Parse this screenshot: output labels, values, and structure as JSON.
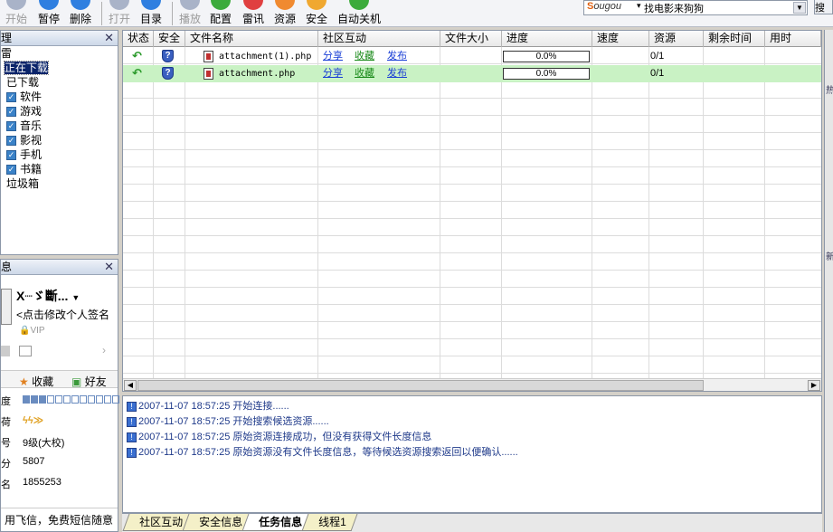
{
  "toolbar": {
    "items": [
      {
        "label": "开始",
        "icon": "start-icon",
        "disabled": true
      },
      {
        "label": "暂停",
        "icon": "pause-icon",
        "disabled": false
      },
      {
        "label": "删除",
        "icon": "delete-icon",
        "disabled": false
      },
      {
        "label": "打开",
        "icon": "open-icon",
        "disabled": true
      },
      {
        "label": "目录",
        "icon": "folder-icon",
        "disabled": false
      },
      {
        "label": "播放",
        "icon": "play-icon",
        "disabled": true
      },
      {
        "label": "配置",
        "icon": "config-icon",
        "disabled": false
      },
      {
        "label": "雷讯",
        "icon": "chat-icon",
        "disabled": false
      },
      {
        "label": "资源",
        "icon": "resource-icon",
        "disabled": false
      },
      {
        "label": "安全",
        "icon": "security-icon",
        "disabled": false
      },
      {
        "label": "自动关机",
        "icon": "shutdown-icon",
        "disabled": false
      }
    ]
  },
  "search": {
    "logo_prefix": "S",
    "logo_text": "ougou",
    "value": "找电影来狗狗",
    "button_label": "搜"
  },
  "task_panel": {
    "title": "理",
    "root": "雷",
    "items": [
      {
        "label": "正在下载",
        "selected": true,
        "checkbox": false
      },
      {
        "label": "已下载",
        "selected": false,
        "checkbox": false
      },
      {
        "label": "软件",
        "selected": false,
        "checkbox": true
      },
      {
        "label": "游戏",
        "selected": false,
        "checkbox": true
      },
      {
        "label": "音乐",
        "selected": false,
        "checkbox": true
      },
      {
        "label": "影视",
        "selected": false,
        "checkbox": true
      },
      {
        "label": "手机",
        "selected": false,
        "checkbox": true
      },
      {
        "label": "书籍",
        "selected": false,
        "checkbox": true
      },
      {
        "label": "垃圾箱",
        "selected": false,
        "checkbox": false
      }
    ]
  },
  "user_panel": {
    "title": "息",
    "username": "X┈ゞ斷...",
    "signature": "<点击修改个人签名",
    "vip": "VIP",
    "tabs": [
      "收藏",
      "好友"
    ],
    "info_rows": [
      {
        "label": "度",
        "value": ""
      },
      {
        "label": "荷",
        "value": ""
      },
      {
        "label": "号",
        "value": "9级(大校)"
      },
      {
        "label": "分",
        "value": "5807"
      },
      {
        "label": "名",
        "value": "1855253"
      }
    ],
    "level_cells": 12,
    "level_filled": 3,
    "ad": "用飞信，免费短信随意"
  },
  "table": {
    "columns": [
      "状态",
      "安全",
      "文件名称",
      "社区互动",
      "文件大小",
      "进度",
      "速度",
      "资源",
      "剩余时间",
      "用时"
    ],
    "rows": [
      {
        "name": "attachment(1).php",
        "share": "分享",
        "fav": "收藏",
        "publish": "发布",
        "size": "",
        "progress": 0.0,
        "progress_text": "0.0%",
        "speed": "",
        "resource": "0/1"
      },
      {
        "name": "attachment.php",
        "share": "分享",
        "fav": "收藏",
        "publish": "发布",
        "size": "",
        "progress": 0.0,
        "progress_text": "0.0%",
        "speed": "",
        "resource": "0/1"
      }
    ]
  },
  "log": {
    "lines": [
      "2007-11-07 18:57:25 开始连接......",
      "2007-11-07 18:57:25 开始搜索候选资源......",
      "2007-11-07 18:57:25 原始资源连接成功，但没有获得文件长度信息",
      "2007-11-07 18:57:25 原始资源没有文件长度信息，等待候选资源搜索返回以便确认......"
    ]
  },
  "bottom_tabs": [
    {
      "label": "社区互动",
      "active": false
    },
    {
      "label": "安全信息",
      "active": false
    },
    {
      "label": "任务信息",
      "active": true
    },
    {
      "label": "线程1",
      "active": false
    }
  ],
  "right_strip": {
    "top": "热",
    "mid": "新"
  },
  "colors": {
    "link_blue": "#1a3fd6",
    "link_green": "#1a8a1a",
    "row_alt": "#c9f2c4",
    "selection": "#0a246a"
  }
}
